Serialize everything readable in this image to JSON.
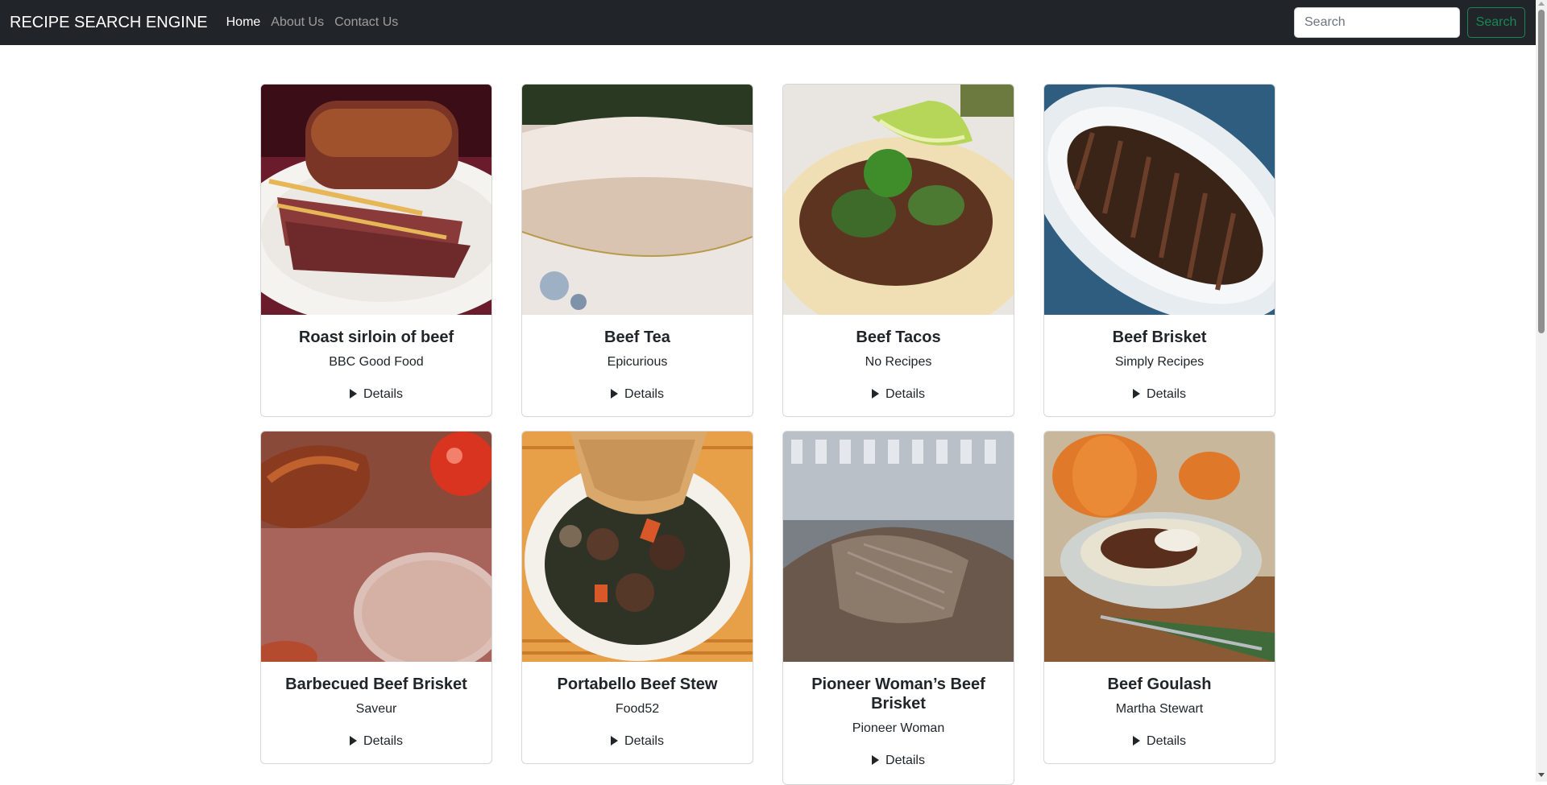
{
  "navbar": {
    "brand": "RECIPE SEARCH ENGINE",
    "links": [
      "Home",
      "About Us",
      "Contact Us"
    ],
    "search_placeholder": "Search",
    "search_button": "Search"
  },
  "colors": {
    "navbar_bg": "#212529",
    "accent": "#198754",
    "card_border": "#d6d6d6"
  },
  "recipes": [
    {
      "title": "Roast sirloin of beef",
      "source": "BBC Good Food",
      "details_label": "Details",
      "image": "roast-beef-image"
    },
    {
      "title": "Beef Tea",
      "source": "Epicurious",
      "details_label": "Details",
      "image": "beef-tea-image"
    },
    {
      "title": "Beef Tacos",
      "source": "No Recipes",
      "details_label": "Details",
      "image": "beef-tacos-image"
    },
    {
      "title": "Beef Brisket",
      "source": "Simply Recipes",
      "details_label": "Details",
      "image": "beef-brisket-image"
    },
    {
      "title": "Barbecued Beef Brisket",
      "source": "Saveur",
      "details_label": "Details",
      "image": "bbq-brisket-image"
    },
    {
      "title": "Portabello Beef Stew",
      "source": "Food52",
      "details_label": "Details",
      "image": "beef-stew-image"
    },
    {
      "title": "Pioneer Woman’s Beef Brisket",
      "source": "Pioneer Woman",
      "details_label": "Details",
      "image": "shredded-brisket-image"
    },
    {
      "title": "Beef Goulash",
      "source": "Martha Stewart",
      "details_label": "Details",
      "image": "goulash-image"
    }
  ]
}
